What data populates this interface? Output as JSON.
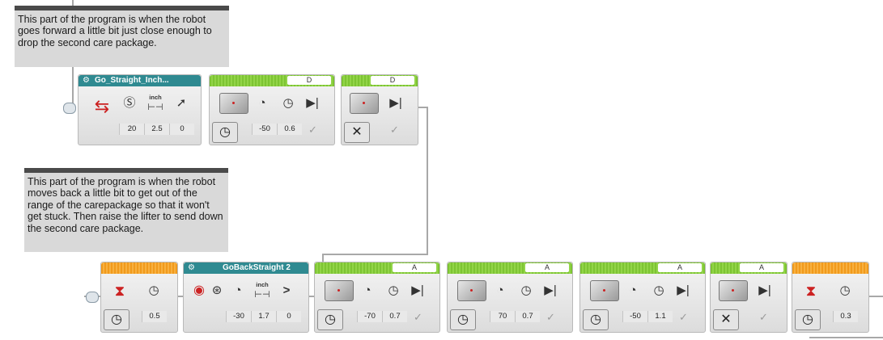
{
  "comments": [
    "This part of the program is when the robot goes forward a little bit just close enough to drop the second care package.",
    "This part of the program is when the robot moves back a little bit to get out of the range of the carepackage so that it won't get stuck. Then raise the lifter to send down the second care package."
  ],
  "row1": {
    "myblock_title": "Go_Straight_Inch...",
    "myblock_values": [
      "20",
      "2.5",
      "0"
    ],
    "inch_label": "inch",
    "motor1_port": "D",
    "motor1_values": [
      "-50",
      "0.6"
    ],
    "motor2_port": "D"
  },
  "row2": {
    "wait1_value": "0.5",
    "myblock_title": "GoBackStraight 2",
    "myblock_values": [
      "-30",
      "1.7",
      "0"
    ],
    "inch_label": "inch",
    "compare_symbol": ">",
    "motor1_port": "A",
    "motor1_values": [
      "-70",
      "0.7"
    ],
    "motor2_port": "A",
    "motor2_values": [
      "70",
      "0.7"
    ],
    "motor3_port": "A",
    "motor3_values": [
      "-50",
      "1.1"
    ],
    "motor4_port": "A",
    "wait2_value": "0.3"
  }
}
